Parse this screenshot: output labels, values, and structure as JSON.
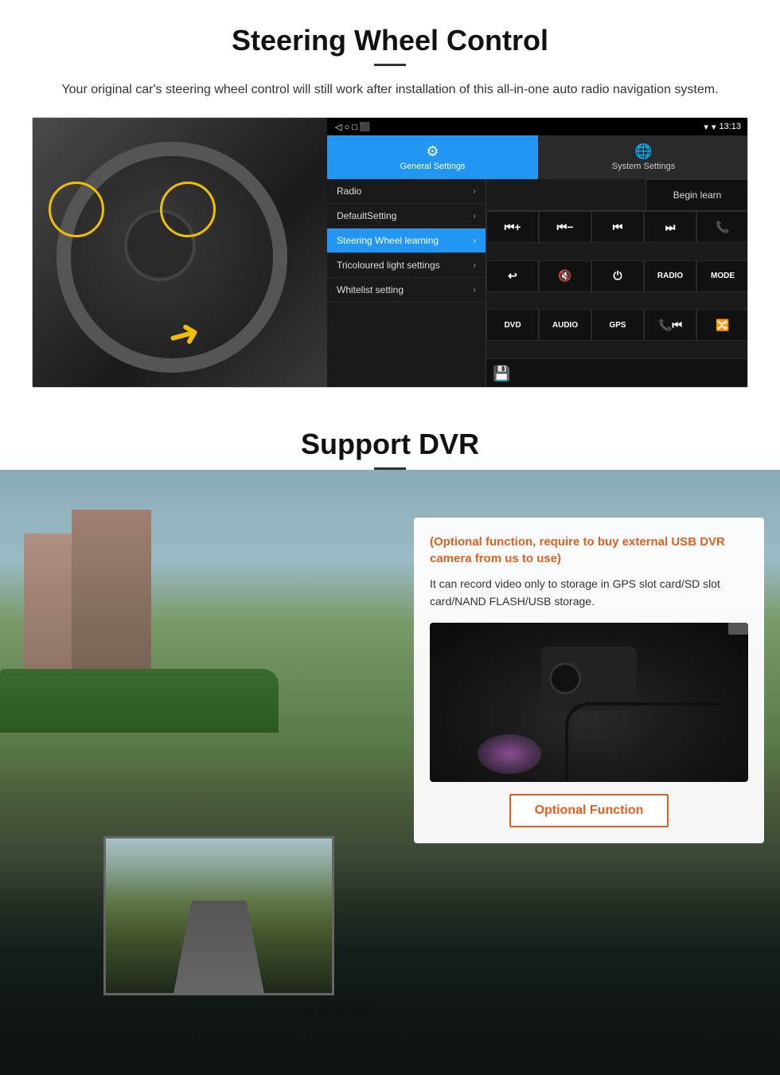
{
  "steering": {
    "title": "Steering Wheel Control",
    "subtitle": "Your original car's steering wheel control will still work after installation of this all-in-one auto radio navigation system.",
    "status_bar": {
      "time": "13:13",
      "wifi": "▾",
      "signal": "▾"
    },
    "tabs": [
      {
        "label": "General Settings",
        "icon": "⚙",
        "active": true
      },
      {
        "label": "System Settings",
        "icon": "🌐",
        "active": false
      }
    ],
    "menu_items": [
      {
        "label": "Radio",
        "active": false
      },
      {
        "label": "DefaultSetting",
        "active": false
      },
      {
        "label": "Steering Wheel learning",
        "active": true
      },
      {
        "label": "Tricoloured light settings",
        "active": false
      },
      {
        "label": "Whitelist setting",
        "active": false
      }
    ],
    "begin_learn": "Begin learn",
    "ctrl_buttons": [
      "⏮+",
      "⏮-",
      "⏮",
      "⏭",
      "📞",
      "↩",
      "🔇",
      "⏻",
      "RADIO",
      "MODE",
      "DVD",
      "AUDIO",
      "GPS",
      "📞⏮",
      "🔀"
    ]
  },
  "dvr": {
    "title": "Support DVR",
    "info_title": "(Optional function, require to buy external USB DVR camera from us to use)",
    "info_text": "It can record video only to storage in GPS slot card/SD slot card/NAND FLASH/USB storage.",
    "optional_label": "Optional Function",
    "seicane_label": "Seicane"
  }
}
